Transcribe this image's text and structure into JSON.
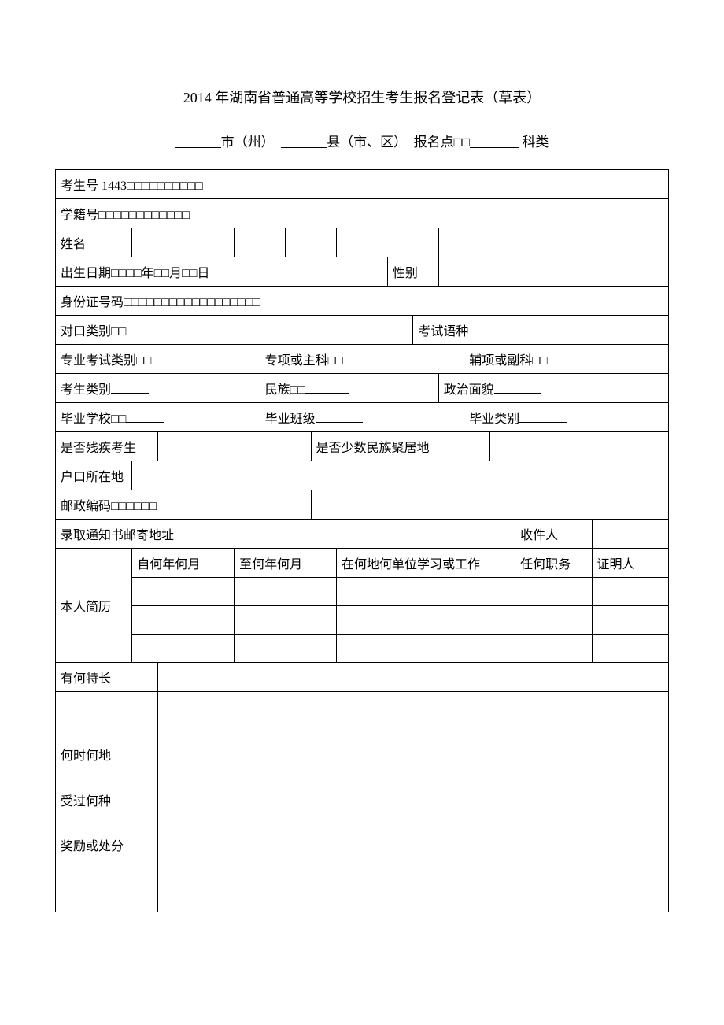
{
  "title": "2014 年湖南省普通高等学校招生考生报名登记表（草表）",
  "subtitle": {
    "city_suffix": "市（州）",
    "county_suffix": "县（市、区）",
    "regpoint_label": "报名点",
    "boxes2": "□□",
    "subject_label": "科类"
  },
  "row_exam_no": {
    "label": "考生号 1443",
    "boxes": "□□□□□□□□□□"
  },
  "row_student_no": {
    "label": "学籍号",
    "boxes": "□□□□□□□□□□□□"
  },
  "row_name": {
    "label": "姓名"
  },
  "row_birth": {
    "label": "出生日期",
    "boxes_year": "□□□□",
    "year": "年",
    "boxes_month": "□□",
    "month": "月",
    "boxes_day": "□□",
    "day": "日",
    "sex_label": "性别"
  },
  "row_idcard": {
    "label": "身份证号码",
    "boxes": "□□□□□□□□□□□□□□□□□□"
  },
  "row_duikou": {
    "label": "对口类别",
    "boxes": "□□",
    "exam_lang_label": "考试语种"
  },
  "row_protest": {
    "label": "专业考试类别",
    "boxes": "□□",
    "zhuanxiang_label": "专项或主科",
    "zhuanxiang_boxes": "□□",
    "fuxiang_label": "辅项或副科",
    "fuxiang_boxes": "□□"
  },
  "row_cat": {
    "label": "考生类别",
    "minzu_label": "民族",
    "minzu_boxes": "□□",
    "zhengzhi_label": "政治面貌"
  },
  "row_school": {
    "label": "毕业学校",
    "boxes": "□□",
    "class_label": "毕业班级",
    "type_label": "毕业类别"
  },
  "row_disab": {
    "left_label": "是否残疾考生",
    "right_label": "是否少数民族聚居地"
  },
  "row_hukou": {
    "label": "户口所在地"
  },
  "row_postal": {
    "label": "邮政编码",
    "boxes": "□□□□□□"
  },
  "row_mail": {
    "label": "录取通知书邮寄地址",
    "recipient_label": "收件人"
  },
  "resume": {
    "label": "本人简历",
    "from": "自何年何月",
    "to": "至何年何月",
    "where": "在何地何单位学习或工作",
    "duty": "任何职务",
    "witness": "证明人"
  },
  "specialty": {
    "label": "有何特长"
  },
  "reward": {
    "line1": "何时何地",
    "line2": "受过何种",
    "line3": "奖励或处分"
  }
}
